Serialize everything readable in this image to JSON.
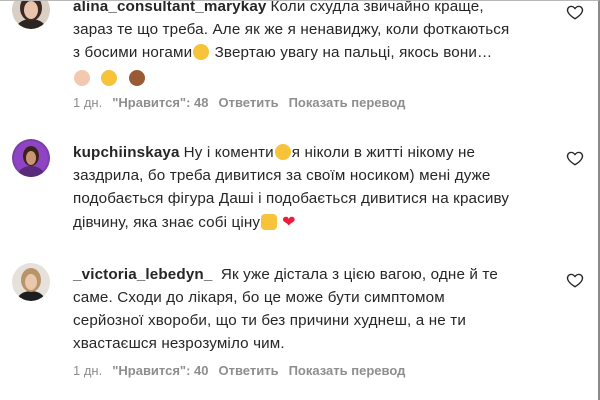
{
  "comments": [
    {
      "username": "alina_consultant_marykay",
      "lines": [
        "Коли схудла звичайно краще,",
        "зараз те що треба. Але як же я ненавиджу, коли фоткаються",
        "з босими ногами",
        "Звертаю увагу на пальці, якось вони…"
      ],
      "time": "1 дн.",
      "likes": "\"Нравится\": 48",
      "reply": "Ответить",
      "translate": "Показать перевод"
    },
    {
      "username": "kupchiinskaya",
      "lines": [
        "Ну і коменти",
        "я ніколи в житті нікому не",
        "заздрила, бо треба дивитися за своїм носиком) мені дуже",
        "подобається фігура Даші і подобається дивитися на красиву",
        "дівчину, яка знає собі ціну"
      ]
    },
    {
      "username": "_victoria_lebedyn_",
      "lines": [
        "Як уже дістала з цією вагою, одне й те",
        "саме. Сходи до лікаря, бо це може бути симптомом",
        "серйозної хвороби, що ти без причини худнеш, а не ти",
        "хвастаєшся незрозуміло чим."
      ],
      "time": "1 дн.",
      "likes": "\"Нравится\": 40",
      "reply": "Ответить",
      "translate": "Показать перевод"
    }
  ],
  "colors": {
    "text": "#262626",
    "meta": "#8e8e8e",
    "heart": "#ed1c3a"
  }
}
